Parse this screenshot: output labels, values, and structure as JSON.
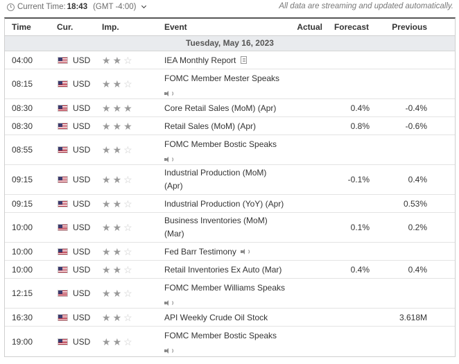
{
  "topbar": {
    "label": "Current Time:",
    "time": "18:43",
    "timezone": "(GMT -4:00)",
    "note": "All data are streaming and updated automatically."
  },
  "table": {
    "headers": {
      "time": "Time",
      "currency": "Cur.",
      "importance": "Imp.",
      "event": "Event",
      "actual": "Actual",
      "forecast": "Forecast",
      "previous": "Previous"
    },
    "date_label": "Tuesday, May 16, 2023",
    "rows": [
      {
        "time": "04:00",
        "currency": "USD",
        "importance": 2,
        "event_lines": [
          "IEA Monthly Report"
        ],
        "icon": "document-icon",
        "actual": "",
        "forecast": "",
        "previous": ""
      },
      {
        "time": "08:15",
        "currency": "USD",
        "importance": 2,
        "event_lines": [
          "FOMC Member Mester Speaks"
        ],
        "icon": "speaker-icon",
        "actual": "",
        "forecast": "",
        "previous": ""
      },
      {
        "time": "08:30",
        "currency": "USD",
        "importance": 3,
        "event_lines": [
          "Core Retail Sales (MoM) (Apr)"
        ],
        "icon": "",
        "actual": "",
        "forecast": "0.4%",
        "previous": "-0.4%"
      },
      {
        "time": "08:30",
        "currency": "USD",
        "importance": 3,
        "event_lines": [
          "Retail Sales (MoM) (Apr)"
        ],
        "icon": "",
        "actual": "",
        "forecast": "0.8%",
        "previous": "-0.6%"
      },
      {
        "time": "08:55",
        "currency": "USD",
        "importance": 2,
        "event_lines": [
          "FOMC Member Bostic Speaks"
        ],
        "icon": "speaker-icon",
        "actual": "",
        "forecast": "",
        "previous": ""
      },
      {
        "time": "09:15",
        "currency": "USD",
        "importance": 2,
        "event_lines": [
          "Industrial Production (MoM)",
          "(Apr)"
        ],
        "icon": "",
        "actual": "",
        "forecast": "-0.1%",
        "previous": "0.4%"
      },
      {
        "time": "09:15",
        "currency": "USD",
        "importance": 2,
        "event_lines": [
          "Industrial Production (YoY) (Apr)"
        ],
        "icon": "",
        "actual": "",
        "forecast": "",
        "previous": "0.53%"
      },
      {
        "time": "10:00",
        "currency": "USD",
        "importance": 2,
        "event_lines": [
          "Business Inventories (MoM)",
          "(Mar)"
        ],
        "icon": "",
        "actual": "",
        "forecast": "0.1%",
        "previous": "0.2%"
      },
      {
        "time": "10:00",
        "currency": "USD",
        "importance": 2,
        "event_lines": [
          "Fed Barr Testimony"
        ],
        "icon": "speaker-icon",
        "actual": "",
        "forecast": "",
        "previous": ""
      },
      {
        "time": "10:00",
        "currency": "USD",
        "importance": 2,
        "event_lines": [
          "Retail Inventories Ex Auto (Mar)"
        ],
        "icon": "",
        "actual": "",
        "forecast": "0.4%",
        "previous": "0.4%"
      },
      {
        "time": "12:15",
        "currency": "USD",
        "importance": 2,
        "event_lines": [
          "FOMC Member Williams Speaks"
        ],
        "icon": "speaker-icon",
        "actual": "",
        "forecast": "",
        "previous": ""
      },
      {
        "time": "16:30",
        "currency": "USD",
        "importance": 2,
        "event_lines": [
          "API Weekly Crude Oil Stock"
        ],
        "icon": "",
        "actual": "",
        "forecast": "",
        "previous": "3.618M"
      },
      {
        "time": "19:00",
        "currency": "USD",
        "importance": 2,
        "event_lines": [
          "FOMC Member Bostic Speaks"
        ],
        "icon": "speaker-icon",
        "actual": "",
        "forecast": "",
        "previous": ""
      }
    ]
  },
  "colors": {
    "header_rule": "#555555",
    "date_row_bg": "#e9ebee",
    "star_on": "#9a9a9a",
    "star_off": "#c9c9c9"
  }
}
